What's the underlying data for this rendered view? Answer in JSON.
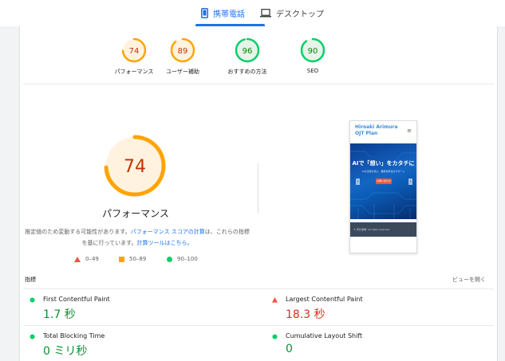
{
  "tabs": [
    {
      "label": "携帯電話",
      "active": true
    },
    {
      "label": "デスクトップ",
      "active": false
    }
  ],
  "scores": [
    {
      "score": 74,
      "label": "パフォーマンス",
      "color": "#ffa400",
      "fill": "#fff3e0",
      "text_color": "#c33300"
    },
    {
      "score": 89,
      "label": "ユーザー補助",
      "color": "#ffa400",
      "fill": "#fff3e0",
      "text_color": "#c33300"
    },
    {
      "score": 96,
      "label": "おすすめの方法",
      "color": "#0cce6b",
      "fill": "#e6f4ea",
      "text_color": "#008800"
    },
    {
      "score": 90,
      "label": "SEO",
      "color": "#0cce6b",
      "fill": "#e6f4ea",
      "text_color": "#008800"
    }
  ],
  "performance": {
    "score": 74,
    "title": "パフォーマンス",
    "desc_1": "推定値のため変動する可能性があります。",
    "desc_link_1": "パフォーマンス スコアの計算",
    "desc_2": "は、これらの指標を基に行っています。",
    "desc_link_2": "計算ツールはこちら。"
  },
  "legend": [
    {
      "range": "0–49",
      "shape": "triangle",
      "color": "#ff4e42"
    },
    {
      "range": "50–89",
      "shape": "square",
      "color": "#ffa400"
    },
    {
      "range": "90–100",
      "shape": "circle",
      "color": "#0cce6b"
    }
  ],
  "preview": {
    "site_title_1": "Hiroaki Arimura",
    "site_title_2": "OJT Plan",
    "menu_icon": "≡",
    "hero_title": "AIで「想い」をカタチに",
    "hero_sub": "AIの活用を通じ、業務効率化のサポート",
    "hero_button": "お問い合わせ",
    "prev_arrow": "‹",
    "next_arrow": "›",
    "footer": "© 有村浩明. All rights reserved."
  },
  "metrics": {
    "header": "指標",
    "expand_label": "ビューを開く",
    "items": [
      {
        "name": "First Contentful Paint",
        "value": "1.7 秒",
        "status": "good"
      },
      {
        "name": "Largest Contentful Paint",
        "value": "18.3 秒",
        "status": "poor"
      },
      {
        "name": "Total Blocking Time",
        "value": "0 ミリ秒",
        "status": "good"
      },
      {
        "name": "Cumulative Layout Shift",
        "value": "0",
        "status": "good"
      }
    ]
  },
  "colors": {
    "accent": "#1a73e8",
    "good": "#0cce6b",
    "average": "#ffa400",
    "poor": "#ff4e42"
  }
}
